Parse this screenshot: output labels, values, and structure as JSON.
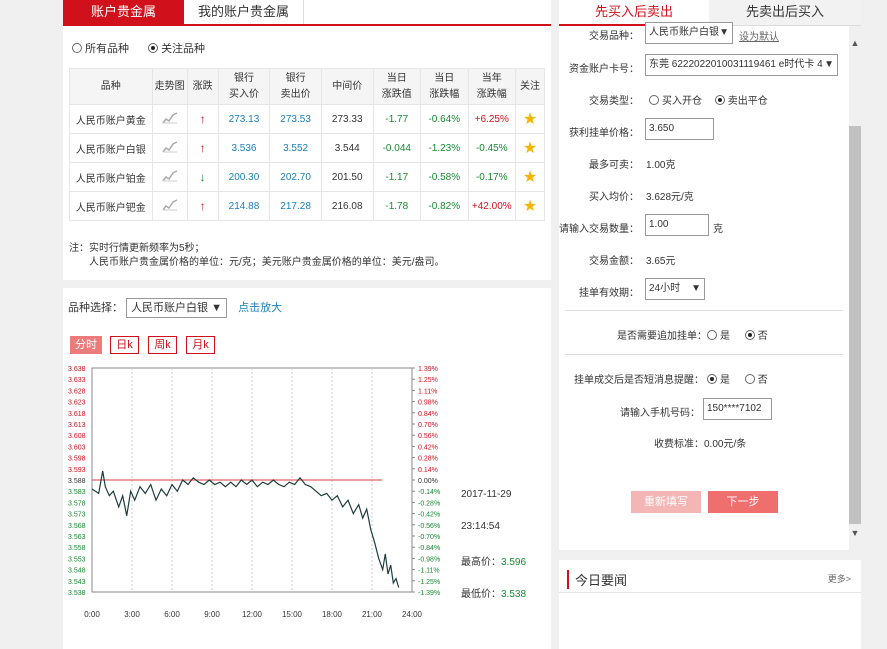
{
  "tabs": [
    "账户贵金属",
    "我的账户贵金属"
  ],
  "filter": {
    "all": "所有品种",
    "watch": "关注品种"
  },
  "table": {
    "headers": [
      "品种",
      "走势图",
      "涨跌",
      "银行\n买入价",
      "银行\n卖出价",
      "中间价",
      "当日\n涨跌值",
      "当日\n涨跌幅",
      "当年\n涨跌幅",
      "关注"
    ],
    "rows": [
      {
        "name": "人民币账户黄金",
        "dir": "up",
        "buy": "273.13",
        "sell": "273.53",
        "mid": "273.33",
        "chg": "-1.77",
        "pct": "-0.64%",
        "ytd": "+6.25%"
      },
      {
        "name": "人民币账户白银",
        "dir": "up",
        "buy": "3.536",
        "sell": "3.552",
        "mid": "3.544",
        "chg": "-0.044",
        "pct": "-1.23%",
        "ytd": "-0.45%"
      },
      {
        "name": "人民币账户铂金",
        "dir": "down",
        "buy": "200.30",
        "sell": "202.70",
        "mid": "201.50",
        "chg": "-1.17",
        "pct": "-0.58%",
        "ytd": "-0.17%"
      },
      {
        "name": "人民币账户钯金",
        "dir": "up",
        "buy": "214.88",
        "sell": "217.28",
        "mid": "216.08",
        "chg": "-1.78",
        "pct": "-0.82%",
        "ytd": "+42.00%"
      }
    ]
  },
  "note": {
    "line1": "注：实时行情更新频率为5秒；",
    "line2": "人民币账户贵金属价格的单位：元/克；美元账户贵金属价格的单位：美元/盎司。"
  },
  "chart_panel": {
    "select_label": "品种选择：",
    "select_value": "人民币账户白银",
    "zoom": "点击放大",
    "periods": [
      "分时",
      "日k",
      "周k",
      "月k"
    ],
    "date": "2017-11-29",
    "time": "23:14:54",
    "high_label": "最高价：",
    "high": "3.596",
    "low_label": "最低价：",
    "low": "3.538"
  },
  "chart_data": {
    "type": "line",
    "y_ticks": [
      "3.638",
      "3.633",
      "3.628",
      "3.623",
      "3.618",
      "3.613",
      "3.608",
      "3.603",
      "3.598",
      "3.593",
      "3.588",
      "3.583",
      "3.578",
      "3.573",
      "3.568",
      "3.563",
      "3.558",
      "3.553",
      "3.548",
      "3.543",
      "3.538"
    ],
    "y2_ticks": [
      "1.39%",
      "1.25%",
      "1.11%",
      "0.98%",
      "0.84%",
      "0.70%",
      "0.56%",
      "0.42%",
      "0.28%",
      "0.14%",
      "0.00%",
      "-0.14%",
      "-0.28%",
      "-0.42%",
      "-0.56%",
      "-0.70%",
      "-0.84%",
      "-0.98%",
      "-1.11%",
      "-1.25%",
      "-1.39%"
    ],
    "x_ticks": [
      "0:00",
      "3:00",
      "6:00",
      "9:00",
      "12:00",
      "15:00",
      "18:00",
      "21:00",
      "24:00"
    ],
    "ylim": [
      3.538,
      3.638
    ],
    "xlim": [
      0,
      24
    ],
    "reference": 3.588,
    "x": [
      0,
      0.5,
      0.8,
      1,
      1.3,
      1.6,
      2,
      2.3,
      2.6,
      2.9,
      3.2,
      3.6,
      4,
      4.4,
      4.8,
      5.2,
      5.6,
      6,
      6.4,
      6.8,
      7.2,
      7.6,
      8,
      8.4,
      8.8,
      9.2,
      9.6,
      10,
      10.4,
      10.8,
      11.2,
      11.6,
      12,
      12.4,
      12.8,
      13.2,
      13.6,
      14,
      14.4,
      14.8,
      15.2,
      15.6,
      16,
      16.4,
      16.8,
      17.2,
      17.6,
      18,
      18.4,
      18.8,
      19.2,
      19.6,
      20,
      20.3,
      20.6,
      20.9,
      21.2,
      21.5,
      21.8,
      22,
      22.2,
      22.4,
      22.6,
      22.8,
      23
    ],
    "values": [
      3.584,
      3.582,
      3.592,
      3.585,
      3.581,
      3.583,
      3.576,
      3.581,
      3.572,
      3.583,
      3.579,
      3.585,
      3.582,
      3.586,
      3.579,
      3.584,
      3.581,
      3.586,
      3.583,
      3.588,
      3.586,
      3.589,
      3.587,
      3.586,
      3.588,
      3.586,
      3.587,
      3.585,
      3.587,
      3.585,
      3.588,
      3.586,
      3.588,
      3.585,
      3.587,
      3.586,
      3.588,
      3.586,
      3.585,
      3.587,
      3.586,
      3.589,
      3.586,
      3.585,
      3.583,
      3.581,
      3.582,
      3.579,
      3.581,
      3.576,
      3.579,
      3.573,
      3.577,
      3.571,
      3.575,
      3.566,
      3.56,
      3.553,
      3.548,
      3.555,
      3.546,
      3.55,
      3.542,
      3.544,
      3.54
    ]
  },
  "right": {
    "tabs": [
      "先买入后卖出",
      "先卖出后买入"
    ],
    "product_label": "交易品种：",
    "product_value": "人民币账户白银",
    "set_default": "设为默认",
    "account_label": "资金账户卡号：",
    "account_value": "东莞 6222022010031119461 e时代卡 4",
    "type_label": "交易类型：",
    "type_open": "买入开仓",
    "type_close": "卖出平仓",
    "profit_label": "获利挂单价格：",
    "profit_value": "3.650",
    "max_label": "最多可卖：",
    "max_value": "1.00克",
    "avg_label": "买入均价：",
    "avg_value": "3.628元/克",
    "qty_label": "请输入交易数量：",
    "qty_value": "1.00",
    "qty_unit": "克",
    "amount_label": "交易金额：",
    "amount_value": "3.65元",
    "valid_label": "挂单有效期：",
    "valid_value": "24小时",
    "add_label": "是否需要追加挂单：",
    "yes": "是",
    "no": "否",
    "sms_label": "挂单成交后是否短消息提醒：",
    "phone_label": "请输入手机号码：",
    "phone_value": "150****7102",
    "fee_label": "收费标准：",
    "fee_value": "0.00元/条",
    "reset": "重新填写",
    "next": "下一步"
  },
  "news": {
    "title": "今日要闻",
    "more": "更多>"
  }
}
